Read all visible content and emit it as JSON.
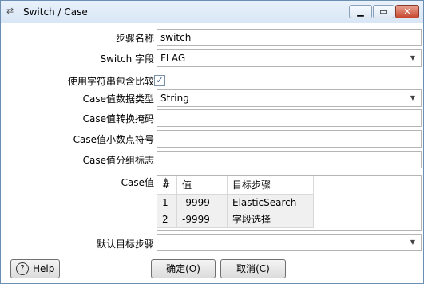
{
  "window": {
    "title": "Switch / Case",
    "app_icon": "switch-arrows-icon"
  },
  "form": {
    "step_name_label": "步骤名称",
    "step_name_value": "switch",
    "switch_field_label": "Switch 字段",
    "switch_field_value": "FLAG",
    "use_contains_label": "使用字符串包含比较",
    "use_contains_checked": true,
    "case_type_label": "Case值数据类型",
    "case_type_value": "String",
    "case_mask_label": "Case值转换掩码",
    "case_mask_value": "",
    "case_decimal_label": "Case值小数点符号",
    "case_decimal_value": "",
    "case_grouping_label": "Case值分组标志",
    "case_grouping_value": "",
    "case_values_label": "Case值",
    "default_target_label": "默认目标步骤",
    "default_target_value": ""
  },
  "table": {
    "headers": [
      "#",
      "值",
      "目标步骤"
    ],
    "rows": [
      {
        "num": "1",
        "value": "-9999",
        "target": "ElasticSearch"
      },
      {
        "num": "2",
        "value": "-9999",
        "target": "字段选择"
      }
    ]
  },
  "buttons": {
    "help": "Help",
    "ok": "确定(O)",
    "cancel": "取消(C)"
  }
}
